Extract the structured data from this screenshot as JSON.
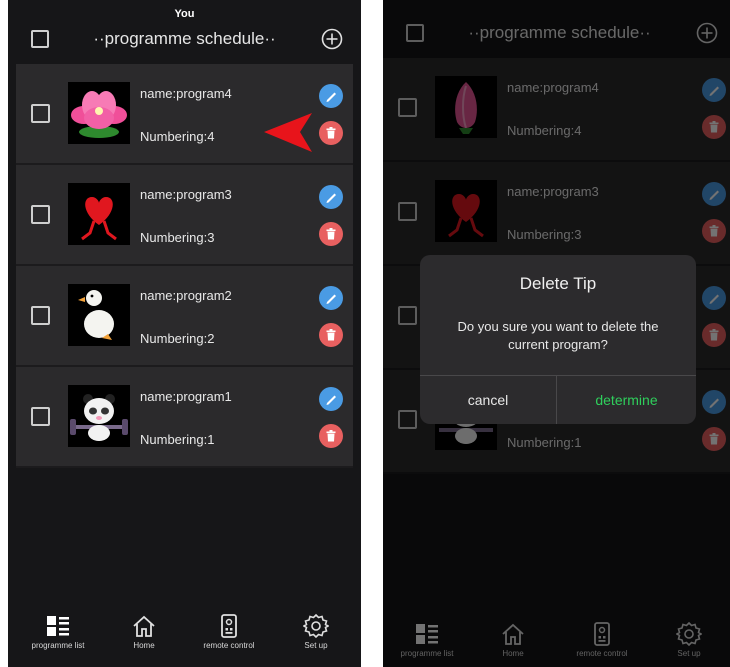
{
  "status_bar": {
    "text": "You"
  },
  "header": {
    "title": "··programme schedule··",
    "add_icon": "plus-circle-icon"
  },
  "programs": [
    {
      "name": "name:program4",
      "numbering": "Numbering:4",
      "image": "pink-flower"
    },
    {
      "name": "name:program3",
      "numbering": "Numbering:3",
      "image": "red-heart-with-legs"
    },
    {
      "name": "name:program2",
      "numbering": "Numbering:2",
      "image": "white-duck"
    },
    {
      "name": "name:program1",
      "numbering": "Numbering:1",
      "image": "panda-lifting-weights"
    }
  ],
  "tabs": [
    {
      "label": "programme list",
      "icon": "list-grid-icon"
    },
    {
      "label": "Home",
      "icon": "home-icon"
    },
    {
      "label": "remote control",
      "icon": "remote-control-icon"
    },
    {
      "label": "Set up",
      "icon": "gear-icon"
    }
  ],
  "dialog": {
    "title": "Delete Tip",
    "message": "Do you sure you want to delete the current program?",
    "cancel": "cancel",
    "confirm": "determine"
  },
  "colors": {
    "background": "#161618",
    "row": "#2b2a2c",
    "edit_button": "#4a9be4",
    "delete_button": "#e86060",
    "confirm_text": "#2fcf5c",
    "pointer_arrow": "#e8141b"
  }
}
